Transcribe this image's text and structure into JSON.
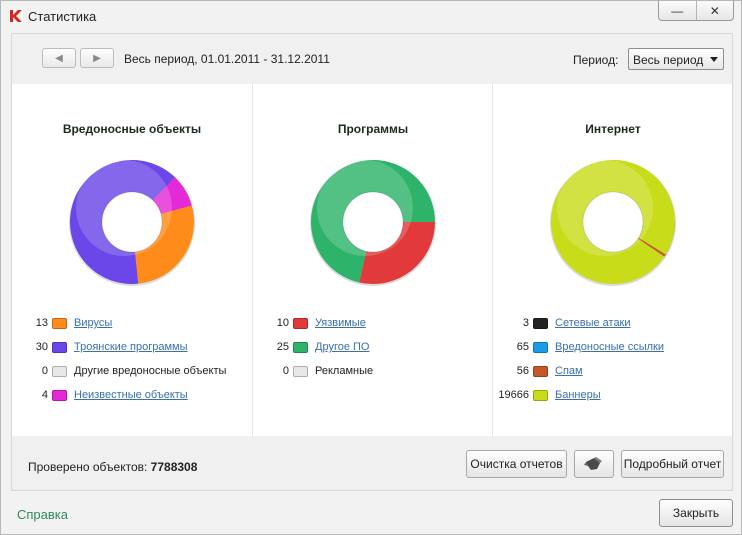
{
  "window": {
    "title": "Статистика",
    "minimize_glyph": "—",
    "close_glyph": "✕"
  },
  "toolbar": {
    "back_glyph": "◀",
    "forward_glyph": "▶",
    "period_text": "Весь период, 01.01.2011 - 31.12.2011",
    "period_label": "Период:",
    "period_value": "Весь период"
  },
  "sections": [
    {
      "title": "Вредоносные объекты",
      "items": [
        {
          "count": "13",
          "label": "Вирусы",
          "color": "#ff8c1a",
          "link": true
        },
        {
          "count": "30",
          "label": "Троянские программы",
          "color": "#6b46e8",
          "link": true
        },
        {
          "count": "0",
          "label": "Другие вредоносные объекты",
          "color": "#e8e8e8",
          "link": false
        },
        {
          "count": "4",
          "label": "Неизвестные объекты",
          "color": "#e629d6",
          "link": true
        }
      ]
    },
    {
      "title": "Программы",
      "items": [
        {
          "count": "10",
          "label": "Уязвимые",
          "color": "#e23a3a",
          "link": true
        },
        {
          "count": "25",
          "label": "Другое ПО",
          "color": "#2eb36a",
          "link": true
        },
        {
          "count": "0",
          "label": "Рекламные",
          "color": "#e8e8e8",
          "link": false
        }
      ]
    },
    {
      "title": "Интернет",
      "items": [
        {
          "count": "3",
          "label": "Сетевые атаки",
          "color": "#222222",
          "link": true
        },
        {
          "count": "65",
          "label": "Вредоносные ссылки",
          "color": "#1a9be8",
          "link": true
        },
        {
          "count": "56",
          "label": "Спам",
          "color": "#c4572a",
          "link": true
        },
        {
          "count": "19666",
          "label": "Баннеры",
          "color": "#c8dc1a",
          "link": true
        }
      ]
    }
  ],
  "footer": {
    "checked_label": "Проверено объектов:",
    "checked_value": "7788308",
    "clear_reports": "Очистка отчетов",
    "detailed_report": "Подробный отчет",
    "help": "Справка",
    "close": "Закрыть"
  },
  "chart_data": [
    {
      "type": "pie",
      "series": [
        {
          "label": "Вирусы",
          "value": 13,
          "color": "#ff8c1a"
        },
        {
          "label": "Троянские программы",
          "value": 30,
          "color": "#6b46e8"
        },
        {
          "label": "Другие вредоносные объекты",
          "value": 0,
          "color": "#e8e8e8"
        },
        {
          "label": "Неизвестные объекты",
          "value": 4,
          "color": "#e629d6"
        }
      ]
    },
    {
      "type": "pie",
      "series": [
        {
          "label": "Уязвимые",
          "value": 10,
          "color": "#e23a3a"
        },
        {
          "label": "Другое ПО",
          "value": 25,
          "color": "#2eb36a"
        },
        {
          "label": "Рекламные",
          "value": 0,
          "color": "#e8e8e8"
        }
      ]
    },
    {
      "type": "pie",
      "series": [
        {
          "label": "Сетевые атаки",
          "value": 3,
          "color": "#222222"
        },
        {
          "label": "Вредоносные ссылки",
          "value": 65,
          "color": "#1a9be8"
        },
        {
          "label": "Спам",
          "value": 56,
          "color": "#c4572a"
        },
        {
          "label": "Баннеры",
          "value": 19666,
          "color": "#c8dc1a"
        }
      ]
    }
  ]
}
